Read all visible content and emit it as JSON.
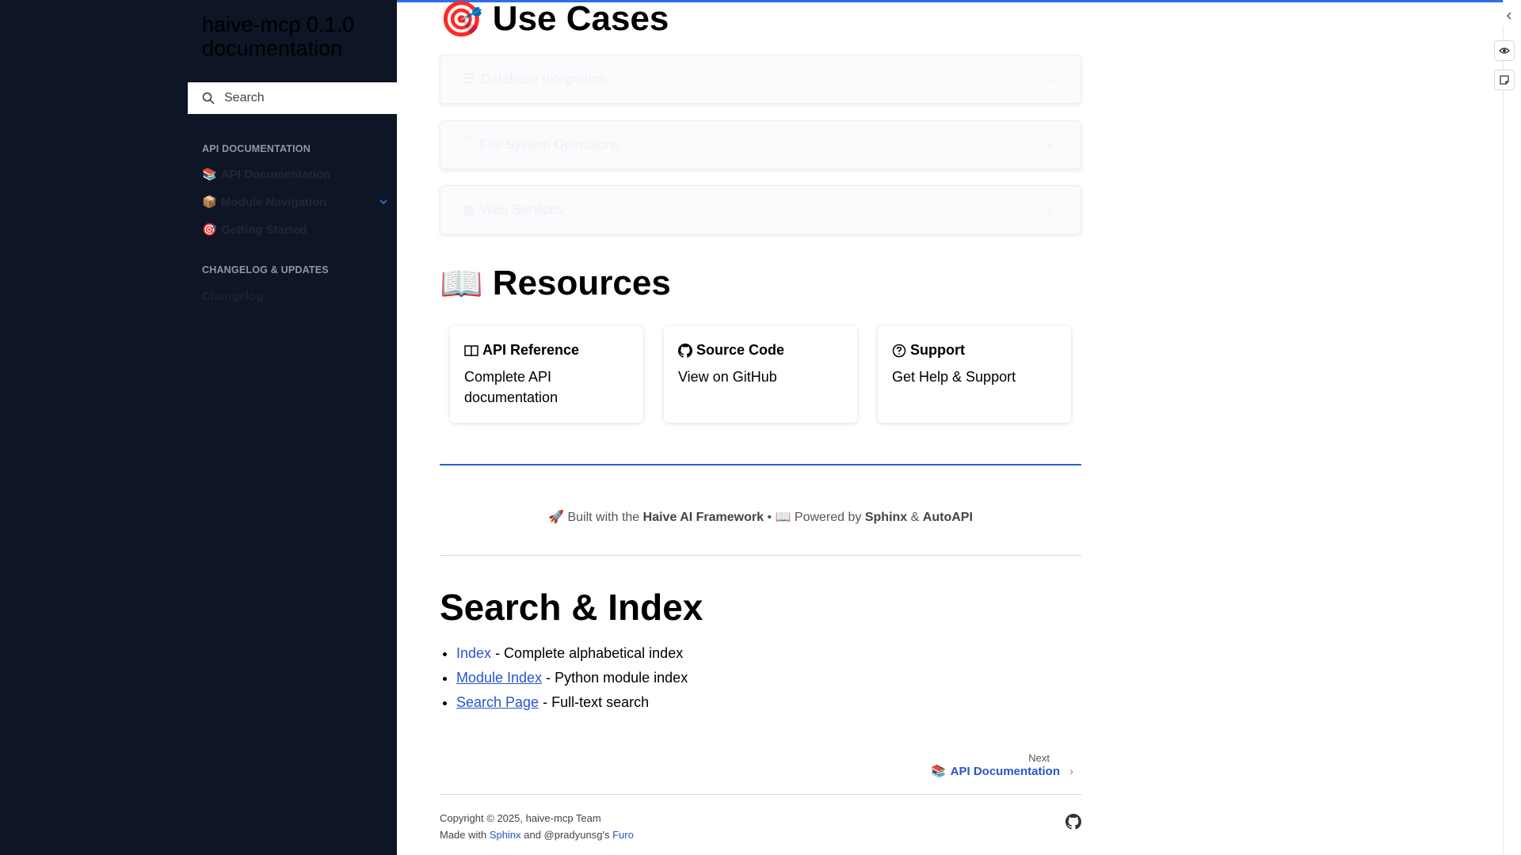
{
  "sidebar": {
    "brand": "haive-mcp 0.1.0 documentation",
    "search": {
      "placeholder": "Search"
    },
    "sections": [
      {
        "caption": "API DOCUMENTATION"
      },
      {
        "caption": "CHANGELOG & UPDATES"
      }
    ],
    "items": [
      {
        "emoji": "📚",
        "label": "API Documentation"
      },
      {
        "emoji": "📦",
        "label": "Module Navigation"
      },
      {
        "emoji": "🎯",
        "label": "Getting Started"
      },
      {
        "emoji": "",
        "label": "Changelog"
      }
    ]
  },
  "main": {
    "use_cases": {
      "emoji": "🎯",
      "title": "Use Cases",
      "panels": [
        {
          "icon": "☰",
          "label": "Database Integration"
        },
        {
          "icon": "🗋",
          "label": "File System Operations"
        },
        {
          "icon": "◍",
          "label": "Web Services"
        }
      ]
    },
    "resources": {
      "emoji": "📖",
      "title": "Resources",
      "cards": [
        {
          "icon": "book-open-icon",
          "title": "API Reference",
          "body": "Complete API documentation"
        },
        {
          "icon": "github-icon",
          "title": "Source Code",
          "body": "View on GitHub"
        },
        {
          "icon": "question-circle-icon",
          "title": "Support",
          "body": "Get Help & Support"
        }
      ]
    },
    "built_with": {
      "rocket": "🚀",
      "prefix": "Built with the",
      "framework": "Haive AI Framework",
      "sep": "•",
      "book": "📖",
      "powered": "Powered by",
      "sphinx": "Sphinx",
      "amp": "&",
      "autoapi": "AutoAPI"
    },
    "search_index": {
      "title": "Search & Index",
      "items": [
        {
          "link": "Index",
          "desc": "- Complete alphabetical index"
        },
        {
          "link": "Module Index",
          "desc": "- Python module index"
        },
        {
          "link": "Search Page",
          "desc": "- Full-text search"
        }
      ]
    },
    "next": {
      "label": "Next",
      "emoji": "📚",
      "title": "API Documentation"
    },
    "footer": {
      "copyright": "Copyright © 2025, haive-mcp Team",
      "made_with": "Made with",
      "sphinx": "Sphinx",
      "and": "and @pradyunsg's",
      "furo": "Furo"
    }
  },
  "colors": {
    "sidebar_bg": "#0e1525",
    "accent": "#2f6fe4",
    "link": "#2a55c8"
  }
}
